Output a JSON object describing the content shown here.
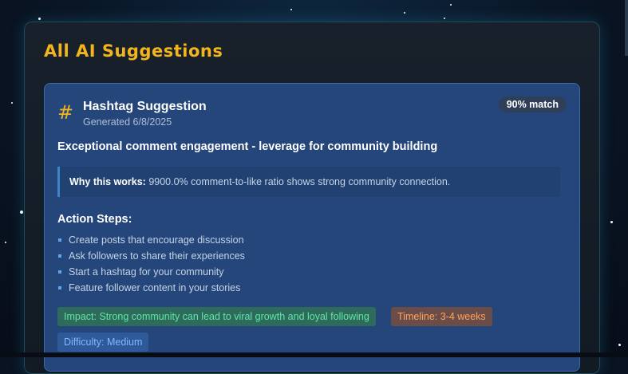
{
  "panel": {
    "title": "All AI Suggestions"
  },
  "card": {
    "icon": "#",
    "title": "Hashtag Suggestion",
    "generated": "Generated 6/8/2025",
    "match": "90% match",
    "headline": "Exceptional comment engagement - leverage for community building",
    "why_label": "Why this works:",
    "why_text": "9900.0% comment-to-like ratio shows strong community connection.",
    "steps_title": "Action Steps:",
    "steps": [
      "Create posts that encourage discussion",
      "Ask followers to share their experiences",
      "Start a hashtag for your community",
      "Feature follower content in your stories"
    ],
    "impact": "Impact: Strong community can lead to viral growth and loyal following",
    "timeline": "Timeline: 3-4 weeks",
    "difficulty": "Difficulty: Medium"
  },
  "colors": {
    "accent": "#f3b51d",
    "card_bg": "#24467a",
    "impact_text": "#5fe6a4",
    "timeline_text": "#ffa35a",
    "difficulty_text": "#7fb8ff"
  }
}
